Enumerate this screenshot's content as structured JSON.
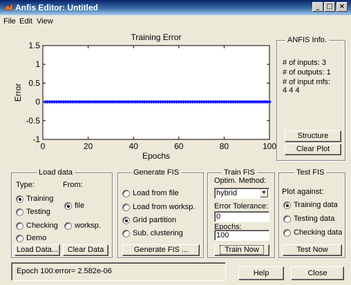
{
  "window": {
    "title": "Anfis Editor: Untitled",
    "buttons": {
      "minimize": "_",
      "maximize": "□",
      "close": "×"
    }
  },
  "menu": [
    {
      "label": "File"
    },
    {
      "label": "Edit"
    },
    {
      "label": "View"
    }
  ],
  "chart_data": {
    "type": "scatter",
    "title": "Training Error",
    "xlabel": "Epochs",
    "ylabel": "Error",
    "xlim": [
      0,
      100
    ],
    "ylim": [
      -1,
      1.5
    ],
    "x_ticks": [
      "0",
      "20",
      "40",
      "60",
      "80",
      "100"
    ],
    "y_ticks": [
      "1.5",
      "1",
      "0.5",
      "0",
      "-0.5",
      "-1"
    ],
    "series": [
      {
        "marker": "asterisk",
        "color": "#0000ff",
        "x_start": 1,
        "x_end": 100,
        "x_step": 1,
        "y": 0
      }
    ],
    "grid": false,
    "background": "#ffffff"
  },
  "anfis_info": {
    "title": "ANFIS Info.",
    "lines": [
      "# of inputs: 3",
      "# of outputs: 1",
      "# of input mfs:",
      "4  4  4"
    ],
    "structure_button": "Structure",
    "clear_plot_button": "Clear Plot"
  },
  "load_data": {
    "title": "Load data",
    "type_label": "Type:",
    "from_label": "From:",
    "types": [
      {
        "label": "Training",
        "selected": true
      },
      {
        "label": "Testing",
        "selected": false
      },
      {
        "label": "Checking",
        "selected": false
      },
      {
        "label": "Demo",
        "selected": false
      }
    ],
    "sources": [
      {
        "label": "file",
        "selected": true
      },
      {
        "label": "worksp.",
        "selected": false
      }
    ],
    "load_button": "Load Data...",
    "clear_button": "Clear Data"
  },
  "generate_fis": {
    "title": "Generate FIS",
    "options": [
      {
        "label": "Load from file",
        "selected": false
      },
      {
        "label": "Load from worksp.",
        "selected": false
      },
      {
        "label": "Grid partition",
        "selected": true
      },
      {
        "label": "Sub. clustering",
        "selected": false
      }
    ],
    "button": "Generate FIS ..."
  },
  "train_fis": {
    "title": "Train FIS",
    "method_label": "Optim. Method:",
    "method_value": "hybrid",
    "tolerance_label": "Error Tolerance:",
    "tolerance_value": "0",
    "epochs_label": "Epochs:",
    "epochs_value": "100",
    "button": "Train Now"
  },
  "test_fis": {
    "title": "Test FIS",
    "plot_against_label": "Plot against:",
    "options": [
      {
        "label": "Training data",
        "selected": true
      },
      {
        "label": "Testing data",
        "selected": false
      },
      {
        "label": "Checking data",
        "selected": false
      }
    ],
    "button": "Test Now"
  },
  "status": {
    "text": "Epoch 100:error= 2.582e-06"
  },
  "footer": {
    "help_button": "Help",
    "close_button": "Close"
  }
}
